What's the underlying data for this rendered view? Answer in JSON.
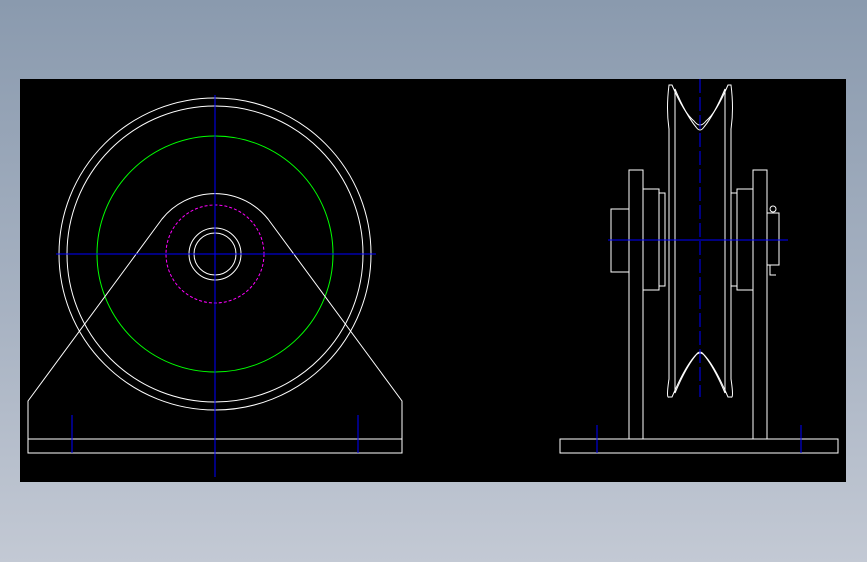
{
  "drawing": {
    "background": "#000000",
    "colors": {
      "outline": "#ffffff",
      "centerline": "#0000ff",
      "pitch_circle": "#00ff00",
      "bearing_circle": "#ff00ff"
    },
    "views": [
      {
        "name": "front-view"
      },
      {
        "name": "side-view"
      }
    ]
  }
}
